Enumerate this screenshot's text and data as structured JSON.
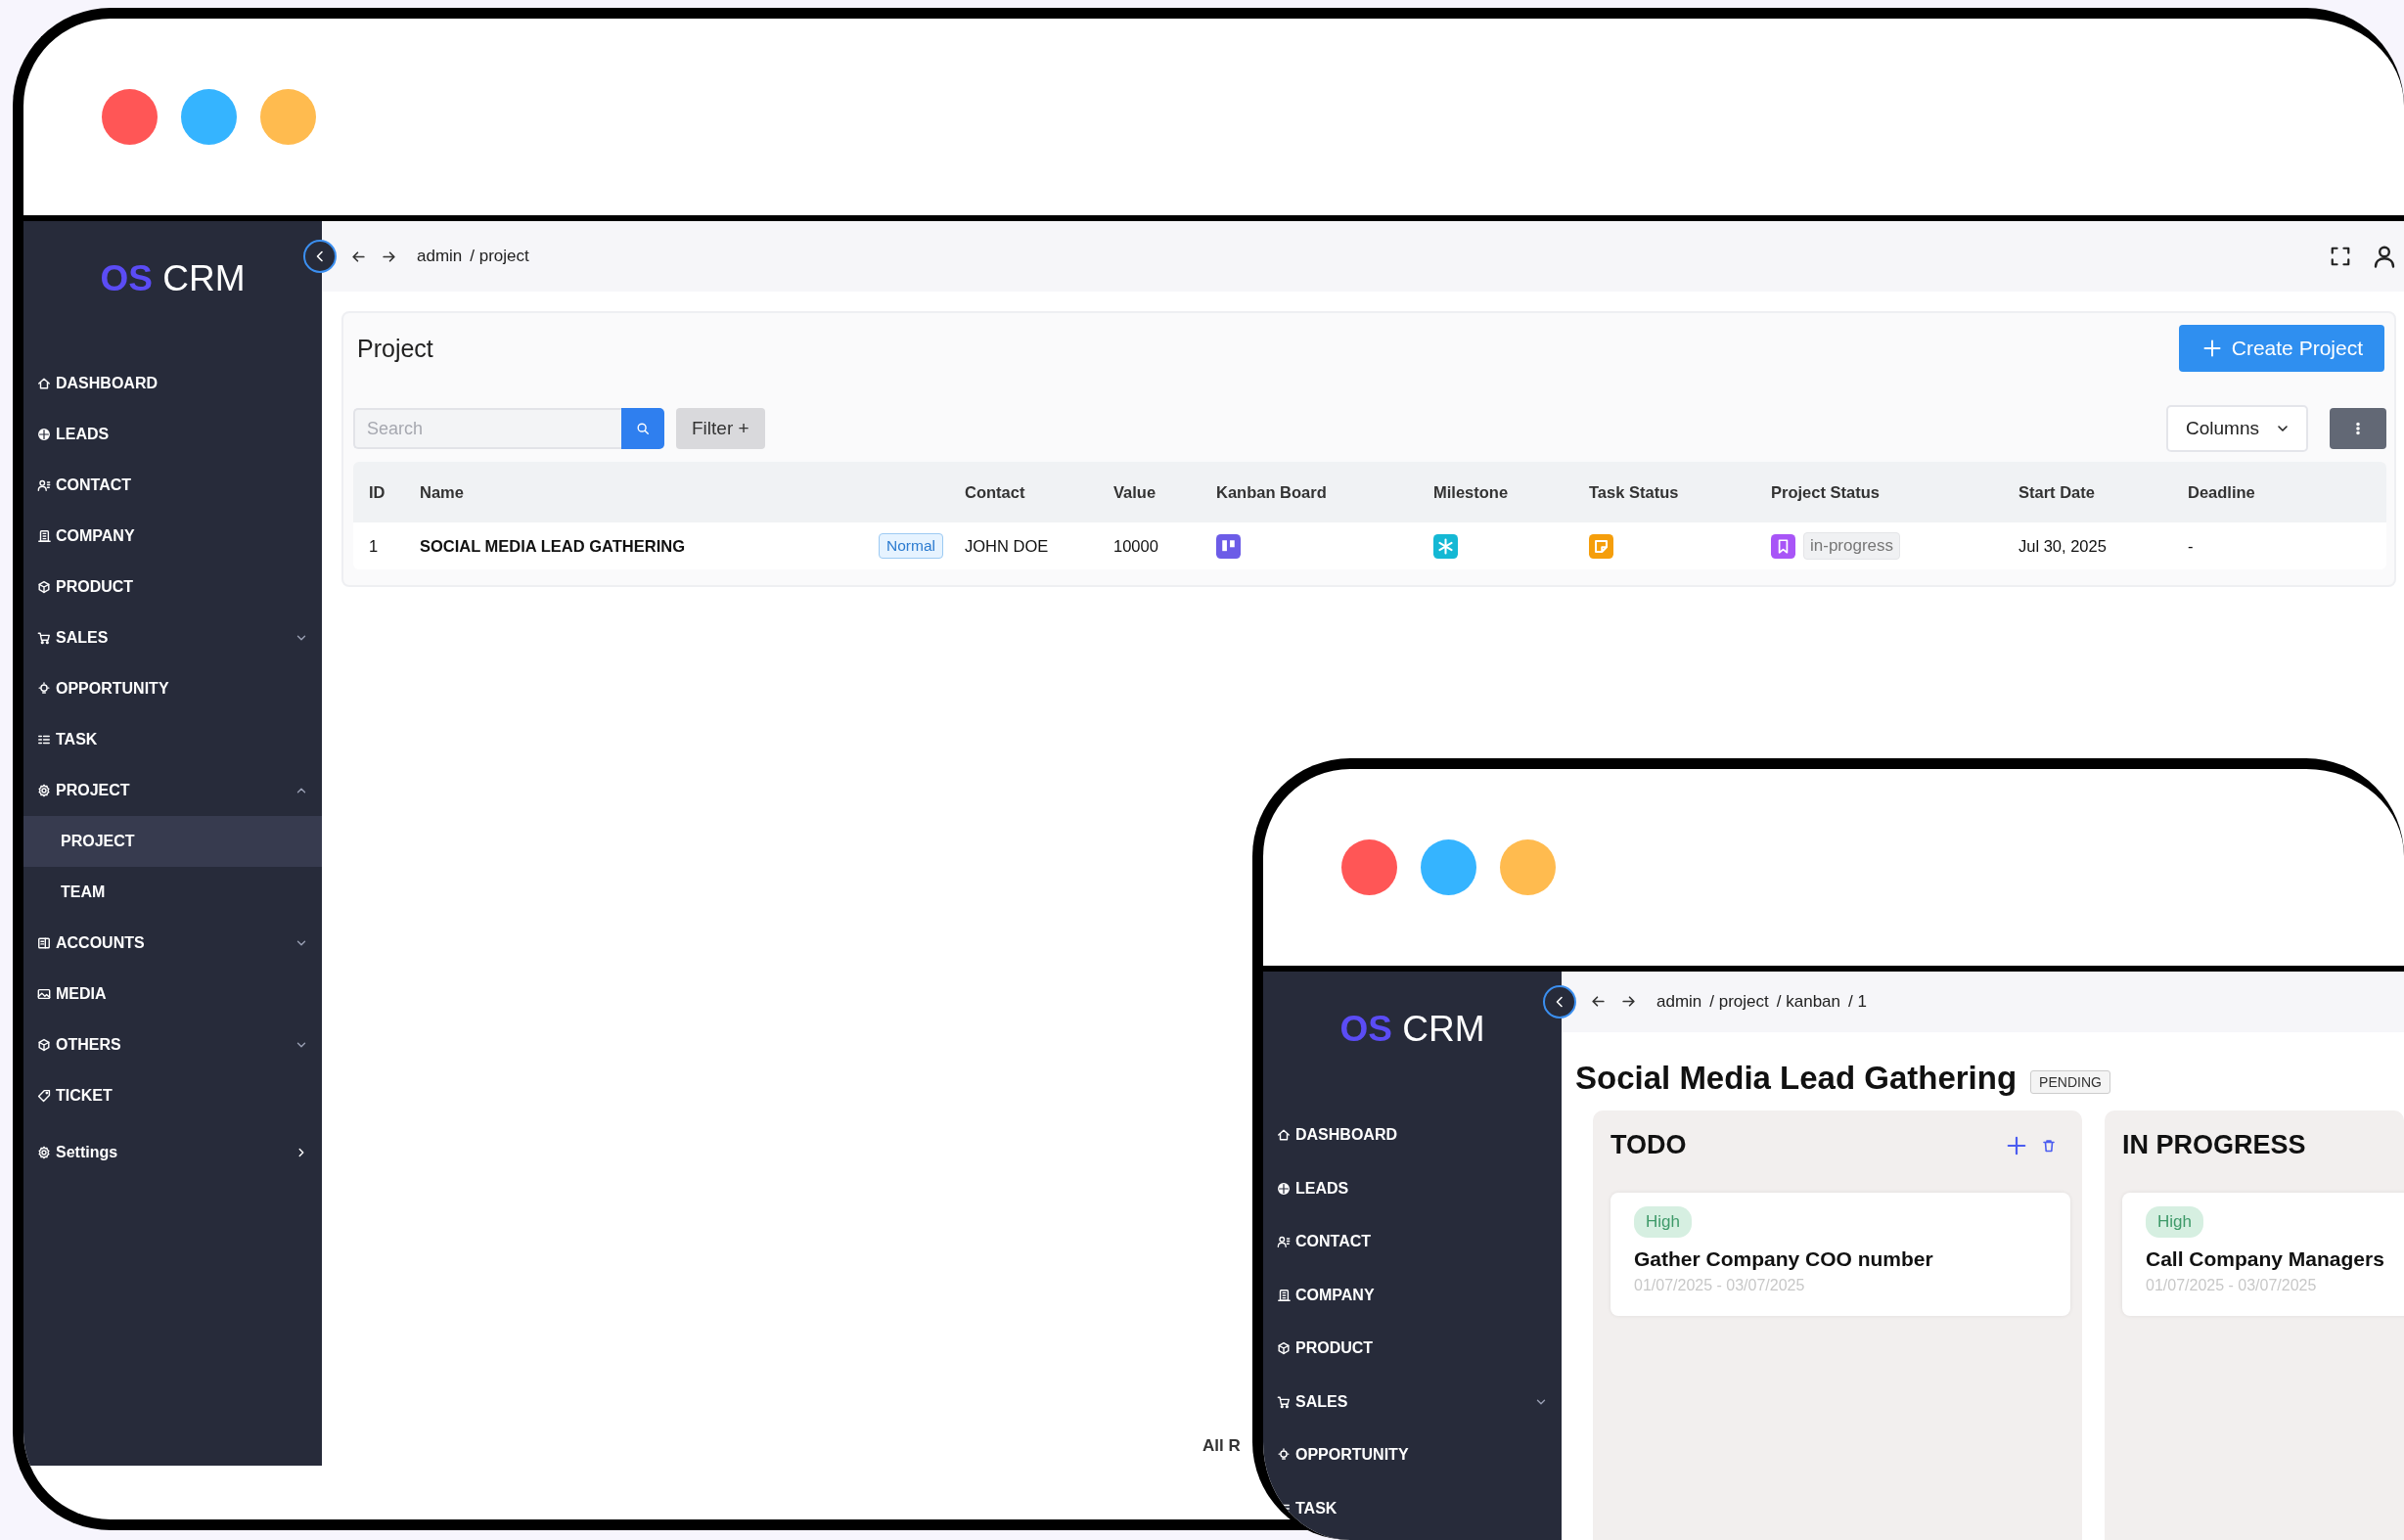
{
  "windows": [
    {
      "kind": "list",
      "sidebar": {
        "logo_mark": "OS",
        "logo_text": "CRM",
        "items": [
          {
            "label": "DASHBOARD",
            "kind": "link",
            "selected": false
          },
          {
            "label": "LEADS",
            "kind": "link",
            "selected": false
          },
          {
            "label": "CONTACT",
            "kind": "link",
            "selected": false
          },
          {
            "label": "COMPANY",
            "kind": "link",
            "selected": false
          },
          {
            "label": "PRODUCT",
            "kind": "link",
            "selected": false
          },
          {
            "label": "SALES",
            "kind": "group",
            "selected": false,
            "expanded": false
          },
          {
            "label": "OPPORTUNITY",
            "kind": "link",
            "selected": false
          },
          {
            "label": "TASK",
            "kind": "link",
            "selected": false
          },
          {
            "label": "PROJECT",
            "kind": "group",
            "selected": false,
            "expanded": true,
            "children": [
              {
                "label": "PROJECT",
                "selected": true
              },
              {
                "label": "TEAM",
                "selected": false
              }
            ]
          },
          {
            "label": "ACCOUNTS",
            "kind": "group",
            "selected": false,
            "expanded": false
          },
          {
            "label": "MEDIA",
            "kind": "link",
            "selected": false
          },
          {
            "label": "OTHERS",
            "kind": "group",
            "selected": false,
            "expanded": false
          },
          {
            "label": "TICKET",
            "kind": "link",
            "selected": false
          },
          {
            "label": "Settings",
            "kind": "page",
            "selected": false
          }
        ]
      },
      "breadcrumb": [
        "admin",
        "/ project"
      ],
      "fullscreen_tools": true,
      "page": {
        "title": "Project",
        "create_button": "Create Project",
        "search": {
          "placeholder": "Search"
        },
        "filter_button": "Filter +",
        "columns_button": "Columns",
        "table": {
          "columns": [
            {
              "label": "ID",
              "kind": "id"
            },
            {
              "label": "Name",
              "kind": "name"
            },
            {
              "label": "Contact",
              "kind": "contact"
            },
            {
              "label": "Value",
              "kind": "value"
            },
            {
              "label": "Kanban Board",
              "kind": "kanban"
            },
            {
              "label": "Milestone",
              "kind": "milestone"
            },
            {
              "label": "Task Status",
              "kind": "task_status"
            },
            {
              "label": "Project Status",
              "kind": "project_status"
            },
            {
              "label": "Start Date",
              "kind": "start_date"
            },
            {
              "label": "Deadline",
              "kind": "deadline"
            }
          ],
          "rows": [
            {
              "id": "1",
              "name": "SOCIAL MEDIA LEAD GATHERING",
              "priority": "Normal",
              "contact": "JOHN DOE",
              "value": "10000",
              "project_status": "in-progress",
              "start_date": "Jul 30, 2025",
              "deadline": "-"
            }
          ]
        }
      },
      "footer": "All R"
    },
    {
      "kind": "kanban",
      "sidebar": {
        "logo_mark": "OS",
        "logo_text": "CRM",
        "items": [
          {
            "label": "DASHBOARD",
            "kind": "link",
            "selected": false
          },
          {
            "label": "LEADS",
            "kind": "link",
            "selected": false
          },
          {
            "label": "CONTACT",
            "kind": "link",
            "selected": false
          },
          {
            "label": "COMPANY",
            "kind": "link",
            "selected": false
          },
          {
            "label": "PRODUCT",
            "kind": "link",
            "selected": false
          },
          {
            "label": "SALES",
            "kind": "group",
            "selected": false,
            "expanded": false
          },
          {
            "label": "OPPORTUNITY",
            "kind": "link",
            "selected": false
          },
          {
            "label": "TASK",
            "kind": "link",
            "selected": false
          }
        ]
      },
      "breadcrumb": [
        "admin",
        "/ project",
        "/ kanban",
        "/ 1"
      ],
      "fullscreen_tools": false,
      "board": {
        "title": "Social Media Lead Gathering",
        "status": "PENDING",
        "columns": [
          {
            "title": "TODO",
            "controls": true,
            "cards": [
              {
                "priority": "High",
                "title": "Gather Company COO number",
                "dates": "01/07/2025 - 03/07/2025"
              }
            ]
          },
          {
            "title": "IN PROGRESS",
            "controls": false,
            "cards": [
              {
                "priority": "High",
                "title": "Call Company Managers",
                "dates": "01/07/2025 - 03/07/2025"
              }
            ]
          }
        ]
      }
    }
  ]
}
